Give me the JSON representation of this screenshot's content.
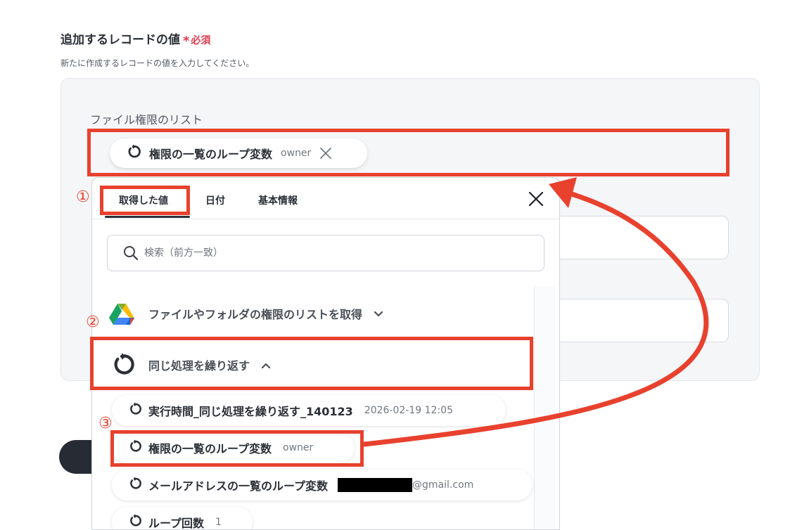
{
  "section": {
    "title": "追加するレコードの値",
    "required_mark": "*",
    "required_label": "必須",
    "description": "新たに作成するレコードの値を入力してください。"
  },
  "field": {
    "label": "ファイル権限のリスト",
    "chip": {
      "icon": "loop-icon",
      "label": "権限の一覧のループ変数",
      "value": "owner"
    }
  },
  "dropdown": {
    "tabs": [
      {
        "label": "取得した値",
        "active": true
      },
      {
        "label": "日付",
        "active": false
      },
      {
        "label": "基本情報",
        "active": false
      }
    ],
    "search_placeholder": "検索（前方一致）",
    "groups": [
      {
        "icon": "google-drive-icon",
        "label": "ファイルやフォルダの権限のリストを取得",
        "expanded": false
      },
      {
        "icon": "loop-icon",
        "label": "同じ処理を繰り返す",
        "expanded": true
      }
    ],
    "items": [
      {
        "icon": "loop-icon",
        "label": "実行時間_同じ処理を繰り返す_140123",
        "value": "2026-02-19 12:05"
      },
      {
        "icon": "loop-icon",
        "label": "権限の一覧のループ変数",
        "value": "owner"
      },
      {
        "icon": "loop-icon",
        "label": "メールアドレスの一覧のループ変数",
        "value_redacted": true,
        "value_suffix": "@gmail.com"
      },
      {
        "icon": "loop-icon",
        "label": "ループ回数",
        "value": "1"
      }
    ]
  },
  "annotations": {
    "step1": "①",
    "step2": "②",
    "step3": "③",
    "color": "#e8412e"
  },
  "colors": {
    "required": "#e03b4f",
    "annotation": "#e8412e",
    "text": "#2b2f36",
    "panel": "#f5f6f8"
  }
}
